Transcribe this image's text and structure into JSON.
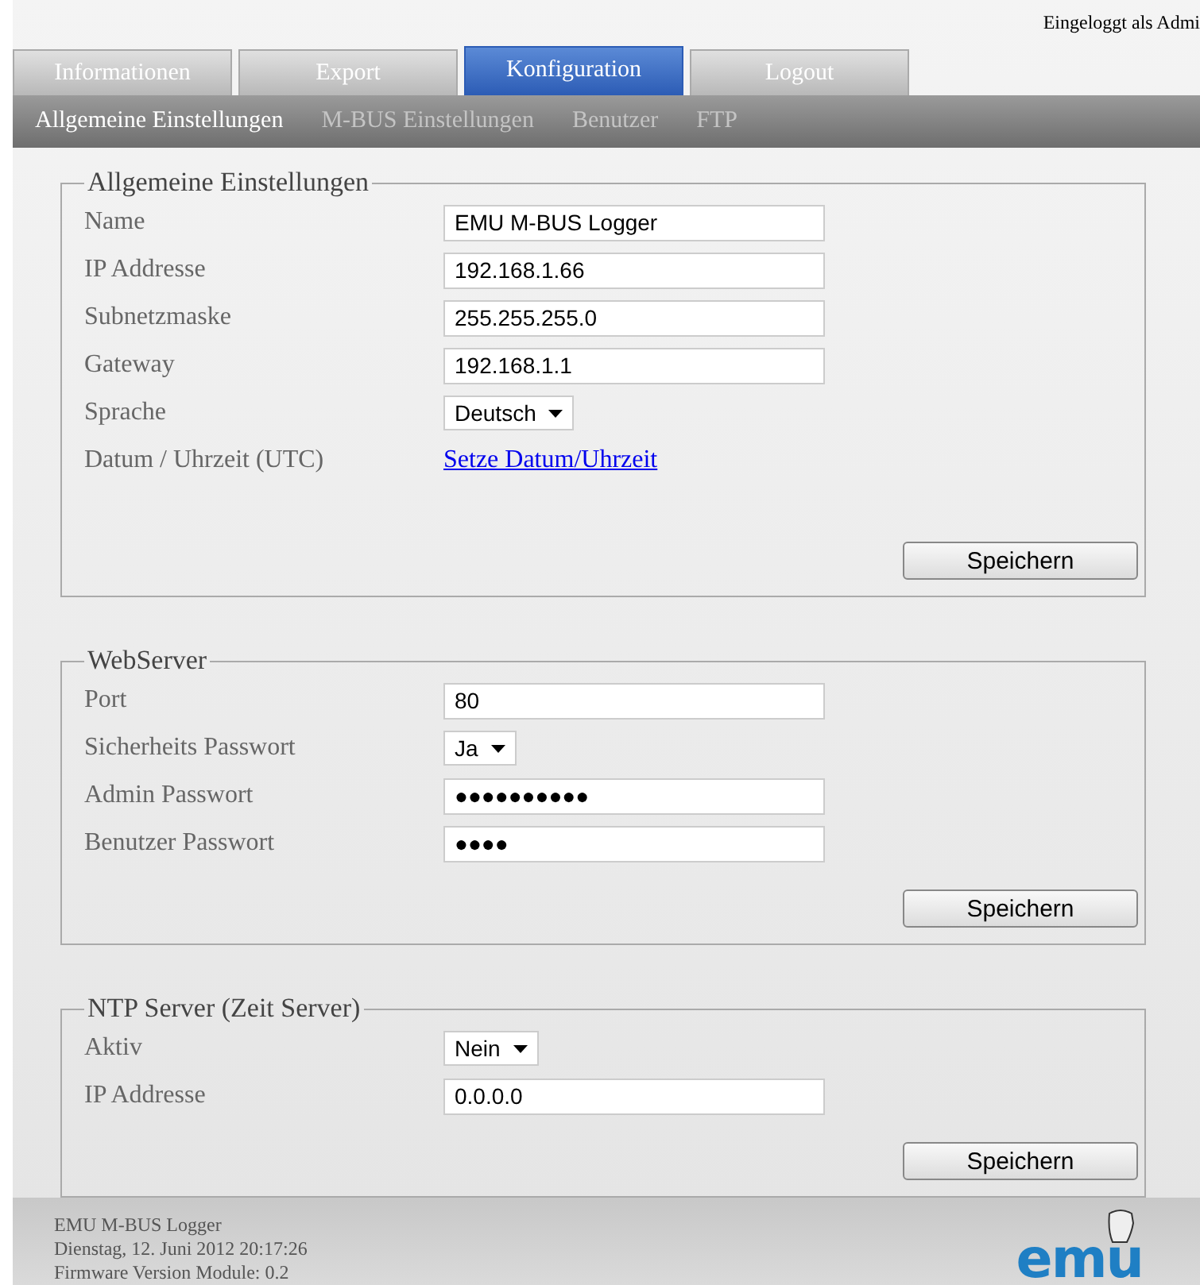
{
  "login_status": "Eingeloggt als Admi",
  "tabs": [
    {
      "label": "Informationen",
      "selected": false
    },
    {
      "label": "Export",
      "selected": false
    },
    {
      "label": "Konfiguration",
      "selected": true
    },
    {
      "label": "Logout",
      "selected": false
    }
  ],
  "subnav": [
    {
      "label": "Allgemeine Einstellungen",
      "selected": true
    },
    {
      "label": "M-BUS Einstellungen",
      "selected": false
    },
    {
      "label": "Benutzer",
      "selected": false
    },
    {
      "label": "FTP",
      "selected": false
    }
  ],
  "sections": [
    {
      "legend": "Allgemeine Einstellungen",
      "button": "Speichern",
      "rows": [
        {
          "kind": "text",
          "label": "Name",
          "value": "EMU M-BUS Logger"
        },
        {
          "kind": "text",
          "label": "IP Addresse",
          "value": "192.168.1.66"
        },
        {
          "kind": "text",
          "label": "Subnetzmaske",
          "value": "255.255.255.0"
        },
        {
          "kind": "text",
          "label": "Gateway",
          "value": "192.168.1.1"
        },
        {
          "kind": "select",
          "label": "Sprache",
          "value": "Deutsch"
        },
        {
          "kind": "link",
          "label": "Datum / Uhrzeit (UTC)",
          "value": "Setze Datum/Uhrzeit"
        }
      ]
    },
    {
      "legend": "WebServer",
      "button": "Speichern",
      "rows": [
        {
          "kind": "text",
          "label": "Port",
          "value": "80"
        },
        {
          "kind": "select",
          "label": "Sicherheits Passwort",
          "value": "Ja"
        },
        {
          "kind": "password",
          "label": "Admin Passwort",
          "value": "●●●●●●●●●●"
        },
        {
          "kind": "password",
          "label": "Benutzer Passwort",
          "value": "●●●●"
        }
      ]
    },
    {
      "legend": "NTP Server (Zeit Server)",
      "button": "Speichern",
      "rows": [
        {
          "kind": "select",
          "label": "Aktiv",
          "value": "Nein"
        },
        {
          "kind": "text",
          "label": "IP Addresse",
          "value": "0.0.0.0"
        }
      ]
    }
  ],
  "footer": {
    "lines": [
      "EMU M-BUS Logger",
      "Dienstag, 12. Juni 2012 20:17:26",
      "Firmware Version Module: 0.2"
    ],
    "logo": "emu"
  }
}
